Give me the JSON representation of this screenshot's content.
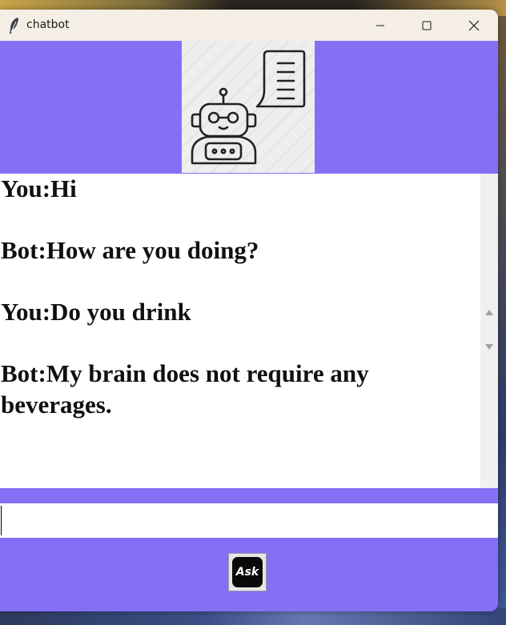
{
  "window": {
    "title": "chatbot",
    "controls": [
      "minimize-icon",
      "maximize-icon",
      "close-icon"
    ],
    "app_icon": "feather-icon"
  },
  "header": {
    "image": "robot-chat-icon"
  },
  "chat": {
    "messages": [
      {
        "text": "You:Hi"
      },
      {
        "text": ""
      },
      {
        "text": "Bot:How are you doing?"
      },
      {
        "text": ""
      },
      {
        "text": "You:Do you drink"
      },
      {
        "text": ""
      },
      {
        "text": "Bot:My brain does not require any beverages."
      }
    ]
  },
  "input": {
    "value": ""
  },
  "ask_button": {
    "label": "Ask"
  },
  "colors": {
    "accent": "#8470f5",
    "titlebar": "#f4eee4",
    "chat_background": "#ffffff"
  }
}
